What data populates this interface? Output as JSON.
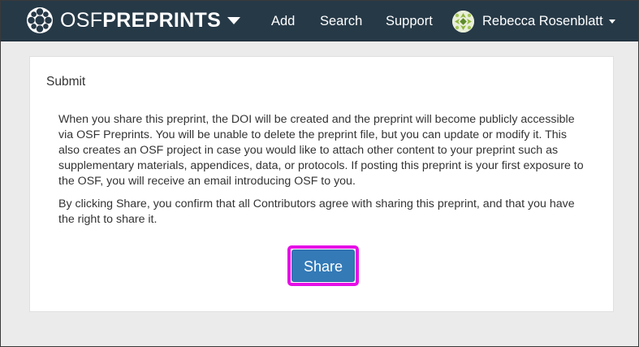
{
  "navbar": {
    "brand_light": "OSF",
    "brand_bold": "PREPRINTS",
    "links": {
      "add": "Add",
      "search": "Search",
      "support": "Support"
    },
    "user": {
      "name": "Rebecca Rosenblatt"
    }
  },
  "panel": {
    "heading": "Submit",
    "paragraphs": [
      "When you share this preprint, the DOI will be created and the preprint will become publicly accessible via OSF Preprints. You will be unable to delete the preprint file, but you can update or modify it. This also creates an OSF project in case you would like to attach other content to your preprint such as supplementary materials, appendices, data, or protocols. If posting this preprint is your first exposure to the OSF, you will receive an email introducing OSF to you.",
      "By clicking Share, you confirm that all Contributors agree with sharing this preprint, and that you have the right to share it."
    ],
    "share_label": "Share"
  },
  "colors": {
    "navbar_bg": "#263947",
    "primary_button": "#337ab7",
    "highlight_outline": "#e60fe6",
    "page_bg": "#ebebeb"
  },
  "icons": {
    "brand": "osf-logo-icon",
    "brand_menu": "caret-down-icon",
    "user_avatar": "avatar",
    "user_menu": "caret-down-icon"
  }
}
